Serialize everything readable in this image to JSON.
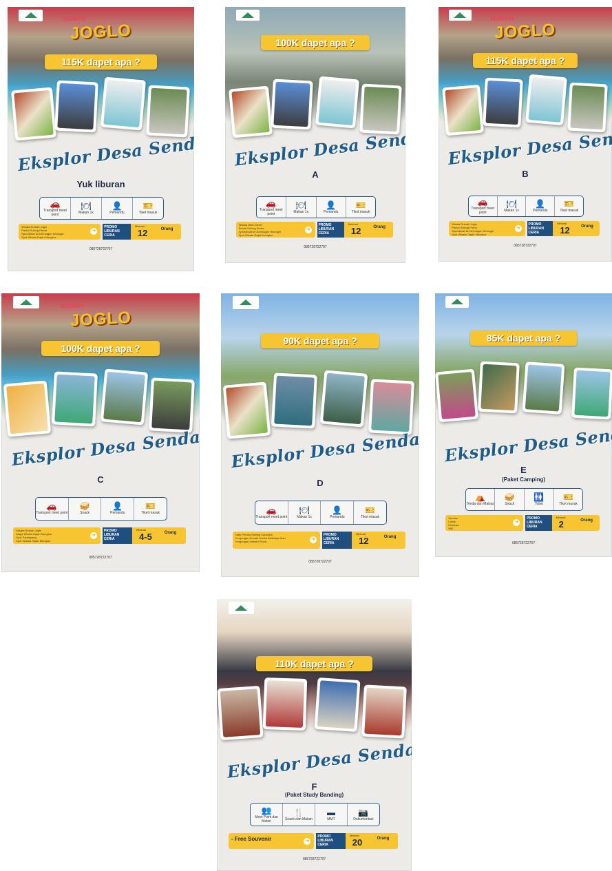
{
  "common": {
    "title": "Eksplor Desa Sendang",
    "phone": "085728722707",
    "promo": "PROMO LIBURAN CERIA",
    "minimal": "Minimal",
    "orang": "Orang",
    "joglo": "JOGLO",
    "joglo_tag": "RUMAH"
  },
  "posters": [
    {
      "id": "intro",
      "price": "115K dapet apa ?",
      "label": "Yuk liburan",
      "sub": "",
      "min_count": "12",
      "features": [
        {
          "icon": "car-icon",
          "label": "Transport meet point"
        },
        {
          "icon": "meal-icon",
          "label": "Makan 1x"
        },
        {
          "icon": "guide-icon",
          "label": "Pemandu"
        },
        {
          "icon": "ticket-icon",
          "label": "Tiket masuk"
        }
      ],
      "items": [
        "Wisata Rumah Joglo",
        "Pantai Sulung Purba",
        "Speedboat ke Dermagan Wonogiri",
        "Spot Wisata Gajah Mungkur"
      ]
    },
    {
      "id": "A",
      "price": "100K dapet apa ?",
      "label": "A",
      "sub": "",
      "min_count": "12",
      "features": [
        {
          "icon": "car-icon",
          "label": "Transport meet point"
        },
        {
          "icon": "meal-icon",
          "label": "Makan 1x"
        },
        {
          "icon": "guide-icon",
          "label": "Pemandu"
        },
        {
          "icon": "ticket-icon",
          "label": "Tiket masuk"
        }
      ],
      "items": [
        "Wisata Waru Genit",
        "Pantai Sulung Purba",
        "Speedboat ke Dermagan Wonogiri",
        "Spot Wisata Gajah Mungkur"
      ]
    },
    {
      "id": "B",
      "price": "115K dapet apa ?",
      "label": "B",
      "sub": "",
      "min_count": "12",
      "features": [
        {
          "icon": "car-icon",
          "label": "Transport meet point"
        },
        {
          "icon": "meal-icon",
          "label": "Makan 1x"
        },
        {
          "icon": "guide-icon",
          "label": "Pemandu"
        },
        {
          "icon": "ticket-icon",
          "label": "Tiket masuk"
        }
      ],
      "items": [
        "Wisata Rumah Joglo",
        "Pantai Sulung Purba",
        "Speedboat ke Dermagan Wonogiri",
        "Spot Wisata Gajah Mungkur"
      ]
    },
    {
      "id": "C",
      "price": "100K dapet apa ?",
      "label": "C",
      "sub": "",
      "min_count": "4-5",
      "features": [
        {
          "icon": "car-icon",
          "label": "Transport meet point"
        },
        {
          "icon": "snack-icon",
          "label": "Snack"
        },
        {
          "icon": "guide-icon",
          "label": "Pemandu"
        },
        {
          "icon": "ticket-icon",
          "label": "Tiket masuk"
        }
      ],
      "items": [
        "Wisata Rumah Joglo",
        "Alaga Wisata Gajah Mungkur",
        "Spot Paralayang",
        "Spot Wisata Gajah Mungkur"
      ]
    },
    {
      "id": "D",
      "price": "90K dapet apa ?",
      "label": "D",
      "sub": "",
      "min_count": "12",
      "features": [
        {
          "icon": "car-icon",
          "label": "Transport meet point"
        },
        {
          "icon": "meal-icon",
          "label": "Makan 1x"
        },
        {
          "icon": "guide-icon",
          "label": "Pemandu"
        },
        {
          "icon": "ticket-icon",
          "label": "Tiket masuk"
        }
      ],
      "items": [
        "Naik Perahu Keliling Karamba",
        "Kunjungan Rumah Usaha Budidaya Ikan",
        "Kunjungan Industri Perca"
      ]
    },
    {
      "id": "E",
      "price": "85K dapet apa ?",
      "label": "E",
      "sub": "(Paket Camping)",
      "min_count": "2",
      "features": [
        {
          "icon": "tent-icon",
          "label": "Tenda dan Matras"
        },
        {
          "icon": "snack-icon",
          "label": "Snack"
        },
        {
          "icon": "toilet-icon",
          "label": "Toilet"
        },
        {
          "icon": "ticket-icon",
          "label": "Tiket masuk"
        }
      ],
      "items": [
        "Sunrise",
        "Listrik",
        "Mushola",
        "Wifi"
      ]
    },
    {
      "id": "F",
      "price": "110K dapet apa ?",
      "label": "F",
      "sub": "(Paket Study Banding)",
      "min_count": "20",
      "features": [
        {
          "icon": "meeting-icon",
          "label": "Meet Point dan Materi"
        },
        {
          "icon": "meal-icon",
          "label": "Snack dan Makan"
        },
        {
          "icon": "banner-icon",
          "label": "MMT"
        },
        {
          "icon": "camera-icon",
          "label": "Dokumentasi"
        }
      ],
      "items": [
        "- Free Souvenir"
      ]
    }
  ]
}
